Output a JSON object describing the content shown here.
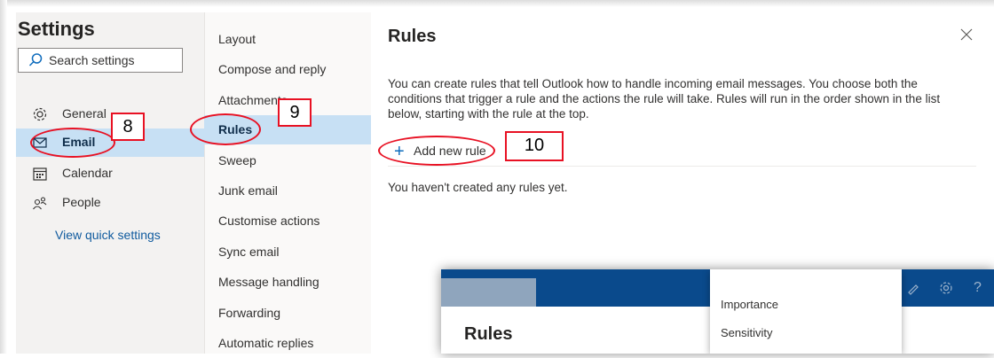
{
  "settings": {
    "title": "Settings",
    "search_placeholder": "Search settings",
    "nav": [
      {
        "label": "General",
        "icon": "gear-icon"
      },
      {
        "label": "Email",
        "icon": "mail-icon"
      },
      {
        "label": "Calendar",
        "icon": "calendar-icon"
      },
      {
        "label": "People",
        "icon": "people-icon"
      }
    ],
    "quick_settings": "View quick settings"
  },
  "email_menu": [
    "Layout",
    "Compose and reply",
    "Attachments",
    "Rules",
    "Sweep",
    "Junk email",
    "Customise actions",
    "Sync email",
    "Message handling",
    "Forwarding",
    "Automatic replies"
  ],
  "rules_panel": {
    "title": "Rules",
    "description": "You can create rules that tell Outlook how to handle incoming email messages. You choose both the conditions that trigger a rule and the actions the rule will take. Rules will run in the order shown in the list below, starting with the rule at the top.",
    "add_label": "Add new rule",
    "empty": "You haven't created any rules yet."
  },
  "callouts": [
    "8",
    "9",
    "10"
  ],
  "inset": {
    "title": "Rules",
    "dropdown_options": [
      "Importance",
      "Sensitivity"
    ]
  },
  "colors": {
    "selected": "#c7e0f4",
    "accent": "#0f6cbd",
    "annotation": "#e81123",
    "inset_bar": "#0a4a8c"
  }
}
